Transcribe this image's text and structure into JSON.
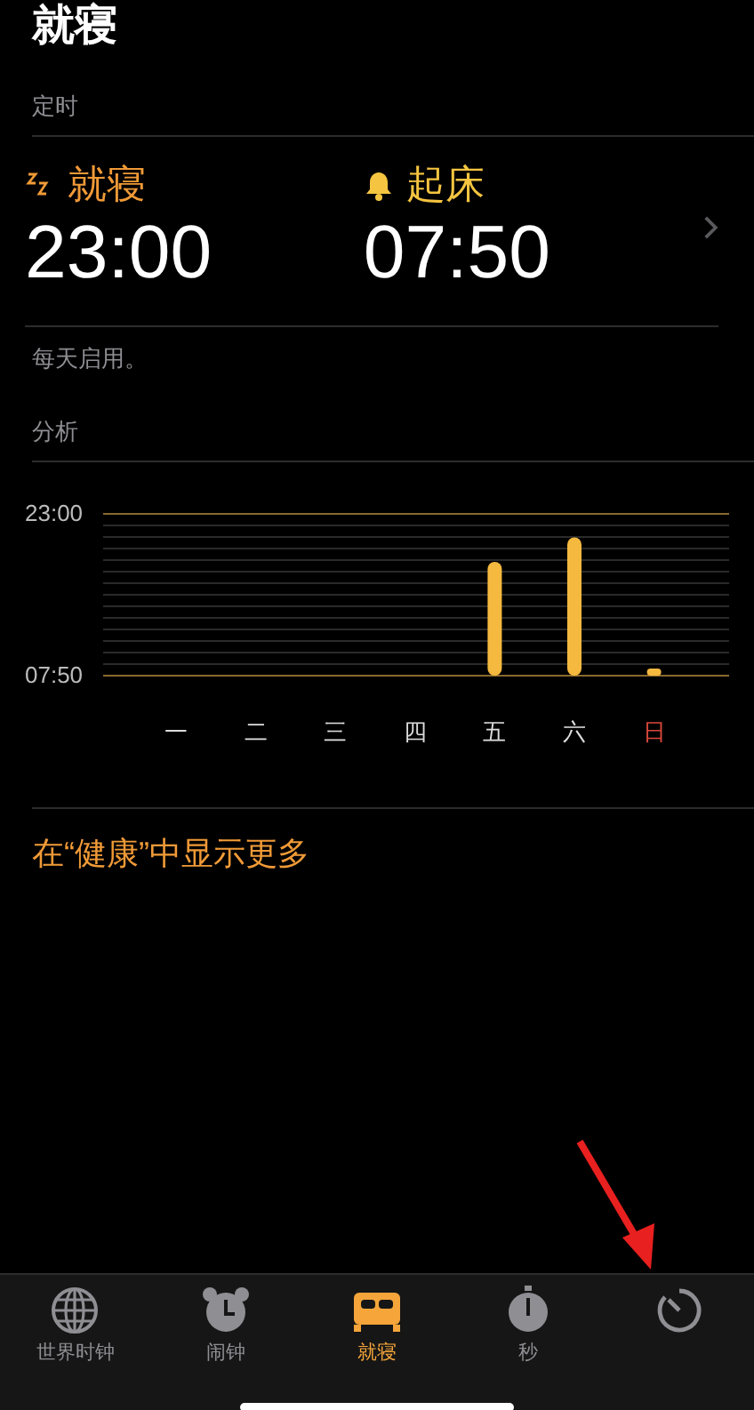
{
  "title": "就寝",
  "schedule": {
    "header": "定时",
    "bedtime": {
      "label": "就寝",
      "time": "23:00"
    },
    "wake": {
      "label": "起床",
      "time": "07:50"
    },
    "note": "每天启用。"
  },
  "analysis": {
    "header": "分析",
    "chart_data": {
      "type": "bar",
      "categories": [
        "一",
        "二",
        "三",
        "四",
        "五",
        "六",
        "日"
      ],
      "series": [
        {
          "color": "#f5b940",
          "values": [
            null,
            null,
            null,
            null,
            18.5,
            20.8,
            8.5
          ]
        }
      ],
      "ylim": [
        7.833,
        23
      ],
      "yticks": [
        {
          "value": 23,
          "label": "23:00"
        },
        {
          "value": 7.833,
          "label": "07:50"
        }
      ]
    },
    "days": [
      {
        "color": "#dddddd"
      },
      {
        "color": "#dddddd"
      },
      {
        "color": "#dddddd"
      },
      {
        "color": "#dddddd"
      },
      {
        "color": "#dddddd"
      },
      {
        "color": "#dddddd"
      },
      {
        "color": "#d9473a"
      }
    ]
  },
  "health_link": "在“健康”中显示更多",
  "tab_bar": [
    {
      "kind": "globe",
      "label": "世界时钟",
      "selected": false
    },
    {
      "kind": "alarm",
      "label": "闹钟",
      "selected": false
    },
    {
      "kind": "bed",
      "label": "就寝",
      "selected": true
    },
    {
      "kind": "stopwatch",
      "label": "秒",
      "selected": false
    },
    {
      "kind": "timer",
      "selected": false
    }
  ]
}
